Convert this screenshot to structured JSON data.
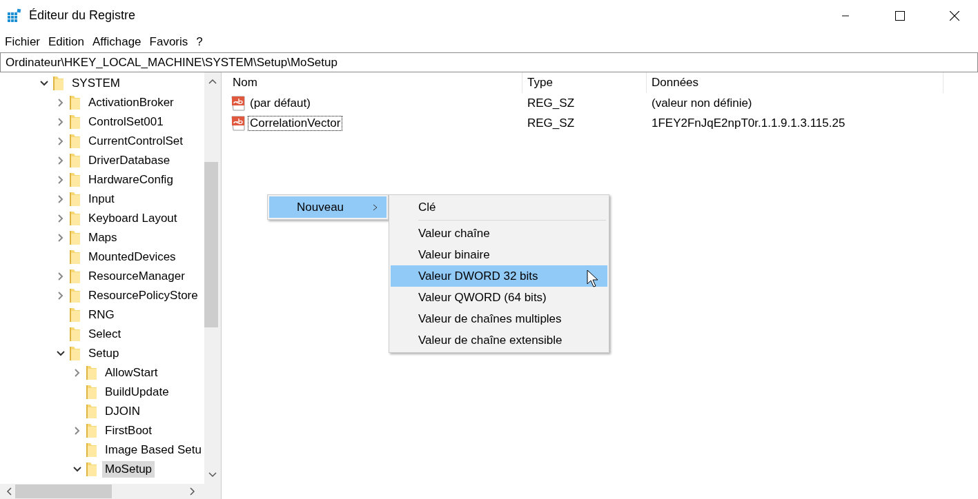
{
  "window": {
    "title": "Éditeur du Registre"
  },
  "menu_bar": [
    "Fichier",
    "Edition",
    "Affichage",
    "Favoris",
    "?"
  ],
  "address": "Ordinateur\\HKEY_LOCAL_MACHINE\\SYSTEM\\Setup\\MoSetup",
  "tree": [
    {
      "label": "SYSTEM",
      "kind": "branch",
      "expanded": true,
      "selected": false,
      "children": [
        {
          "label": "ActivationBroker",
          "kind": "branch",
          "expanded": false,
          "selected": false
        },
        {
          "label": "ControlSet001",
          "kind": "branch",
          "expanded": false,
          "selected": false
        },
        {
          "label": "CurrentControlSet",
          "kind": "branch",
          "expanded": false,
          "selected": false
        },
        {
          "label": "DriverDatabase",
          "kind": "branch",
          "expanded": false,
          "selected": false
        },
        {
          "label": "HardwareConfig",
          "kind": "branch",
          "expanded": false,
          "selected": false
        },
        {
          "label": "Input",
          "kind": "branch",
          "expanded": false,
          "selected": false
        },
        {
          "label": "Keyboard Layout",
          "kind": "branch",
          "expanded": false,
          "selected": false
        },
        {
          "label": "Maps",
          "kind": "branch",
          "expanded": false,
          "selected": false
        },
        {
          "label": "MountedDevices",
          "kind": "leaf",
          "selected": false
        },
        {
          "label": "ResourceManager",
          "kind": "branch",
          "expanded": false,
          "selected": false
        },
        {
          "label": "ResourcePolicyStore",
          "kind": "branch",
          "expanded": false,
          "selected": false
        },
        {
          "label": "RNG",
          "kind": "leaf",
          "selected": false
        },
        {
          "label": "Select",
          "kind": "leaf",
          "selected": false
        },
        {
          "label": "Setup",
          "kind": "branch",
          "expanded": true,
          "selected": false,
          "children": [
            {
              "label": "AllowStart",
              "kind": "branch",
              "expanded": false,
              "selected": false
            },
            {
              "label": "BuildUpdate",
              "kind": "leaf",
              "selected": false
            },
            {
              "label": "DJOIN",
              "kind": "leaf",
              "selected": false
            },
            {
              "label": "FirstBoot",
              "kind": "branch",
              "expanded": false,
              "selected": false
            },
            {
              "label": "Image Based Setu",
              "kind": "leaf",
              "selected": false
            },
            {
              "label": "MoSetup",
              "kind": "branch",
              "expanded": true,
              "selected": true
            }
          ]
        }
      ]
    }
  ],
  "values": {
    "columns": [
      "Nom",
      "Type",
      "Données"
    ],
    "rows": [
      {
        "name": "(par défaut)",
        "type": "REG_SZ",
        "data": "(valeur non définie)",
        "focused": false
      },
      {
        "name": "CorrelationVector",
        "type": "REG_SZ",
        "data": "1FEY2FnJqE2npT0r.1.1.9.1.3.115.25",
        "focused": true
      }
    ]
  },
  "context_menu": {
    "items": [
      {
        "label": "Nouveau",
        "selected": true
      }
    ]
  },
  "submenu": {
    "items": [
      {
        "kind": "item",
        "label": "Clé",
        "selected": false
      },
      {
        "kind": "separator"
      },
      {
        "kind": "item",
        "label": "Valeur chaîne",
        "selected": false
      },
      {
        "kind": "item",
        "label": "Valeur binaire",
        "selected": false
      },
      {
        "kind": "item",
        "label": "Valeur DWORD 32 bits",
        "selected": true
      },
      {
        "kind": "item",
        "label": "Valeur QWORD (64 bits)",
        "selected": false
      },
      {
        "kind": "item",
        "label": "Valeur de chaînes multiples",
        "selected": false
      },
      {
        "kind": "item",
        "label": "Valeur de chaîne extensible",
        "selected": false
      }
    ]
  }
}
